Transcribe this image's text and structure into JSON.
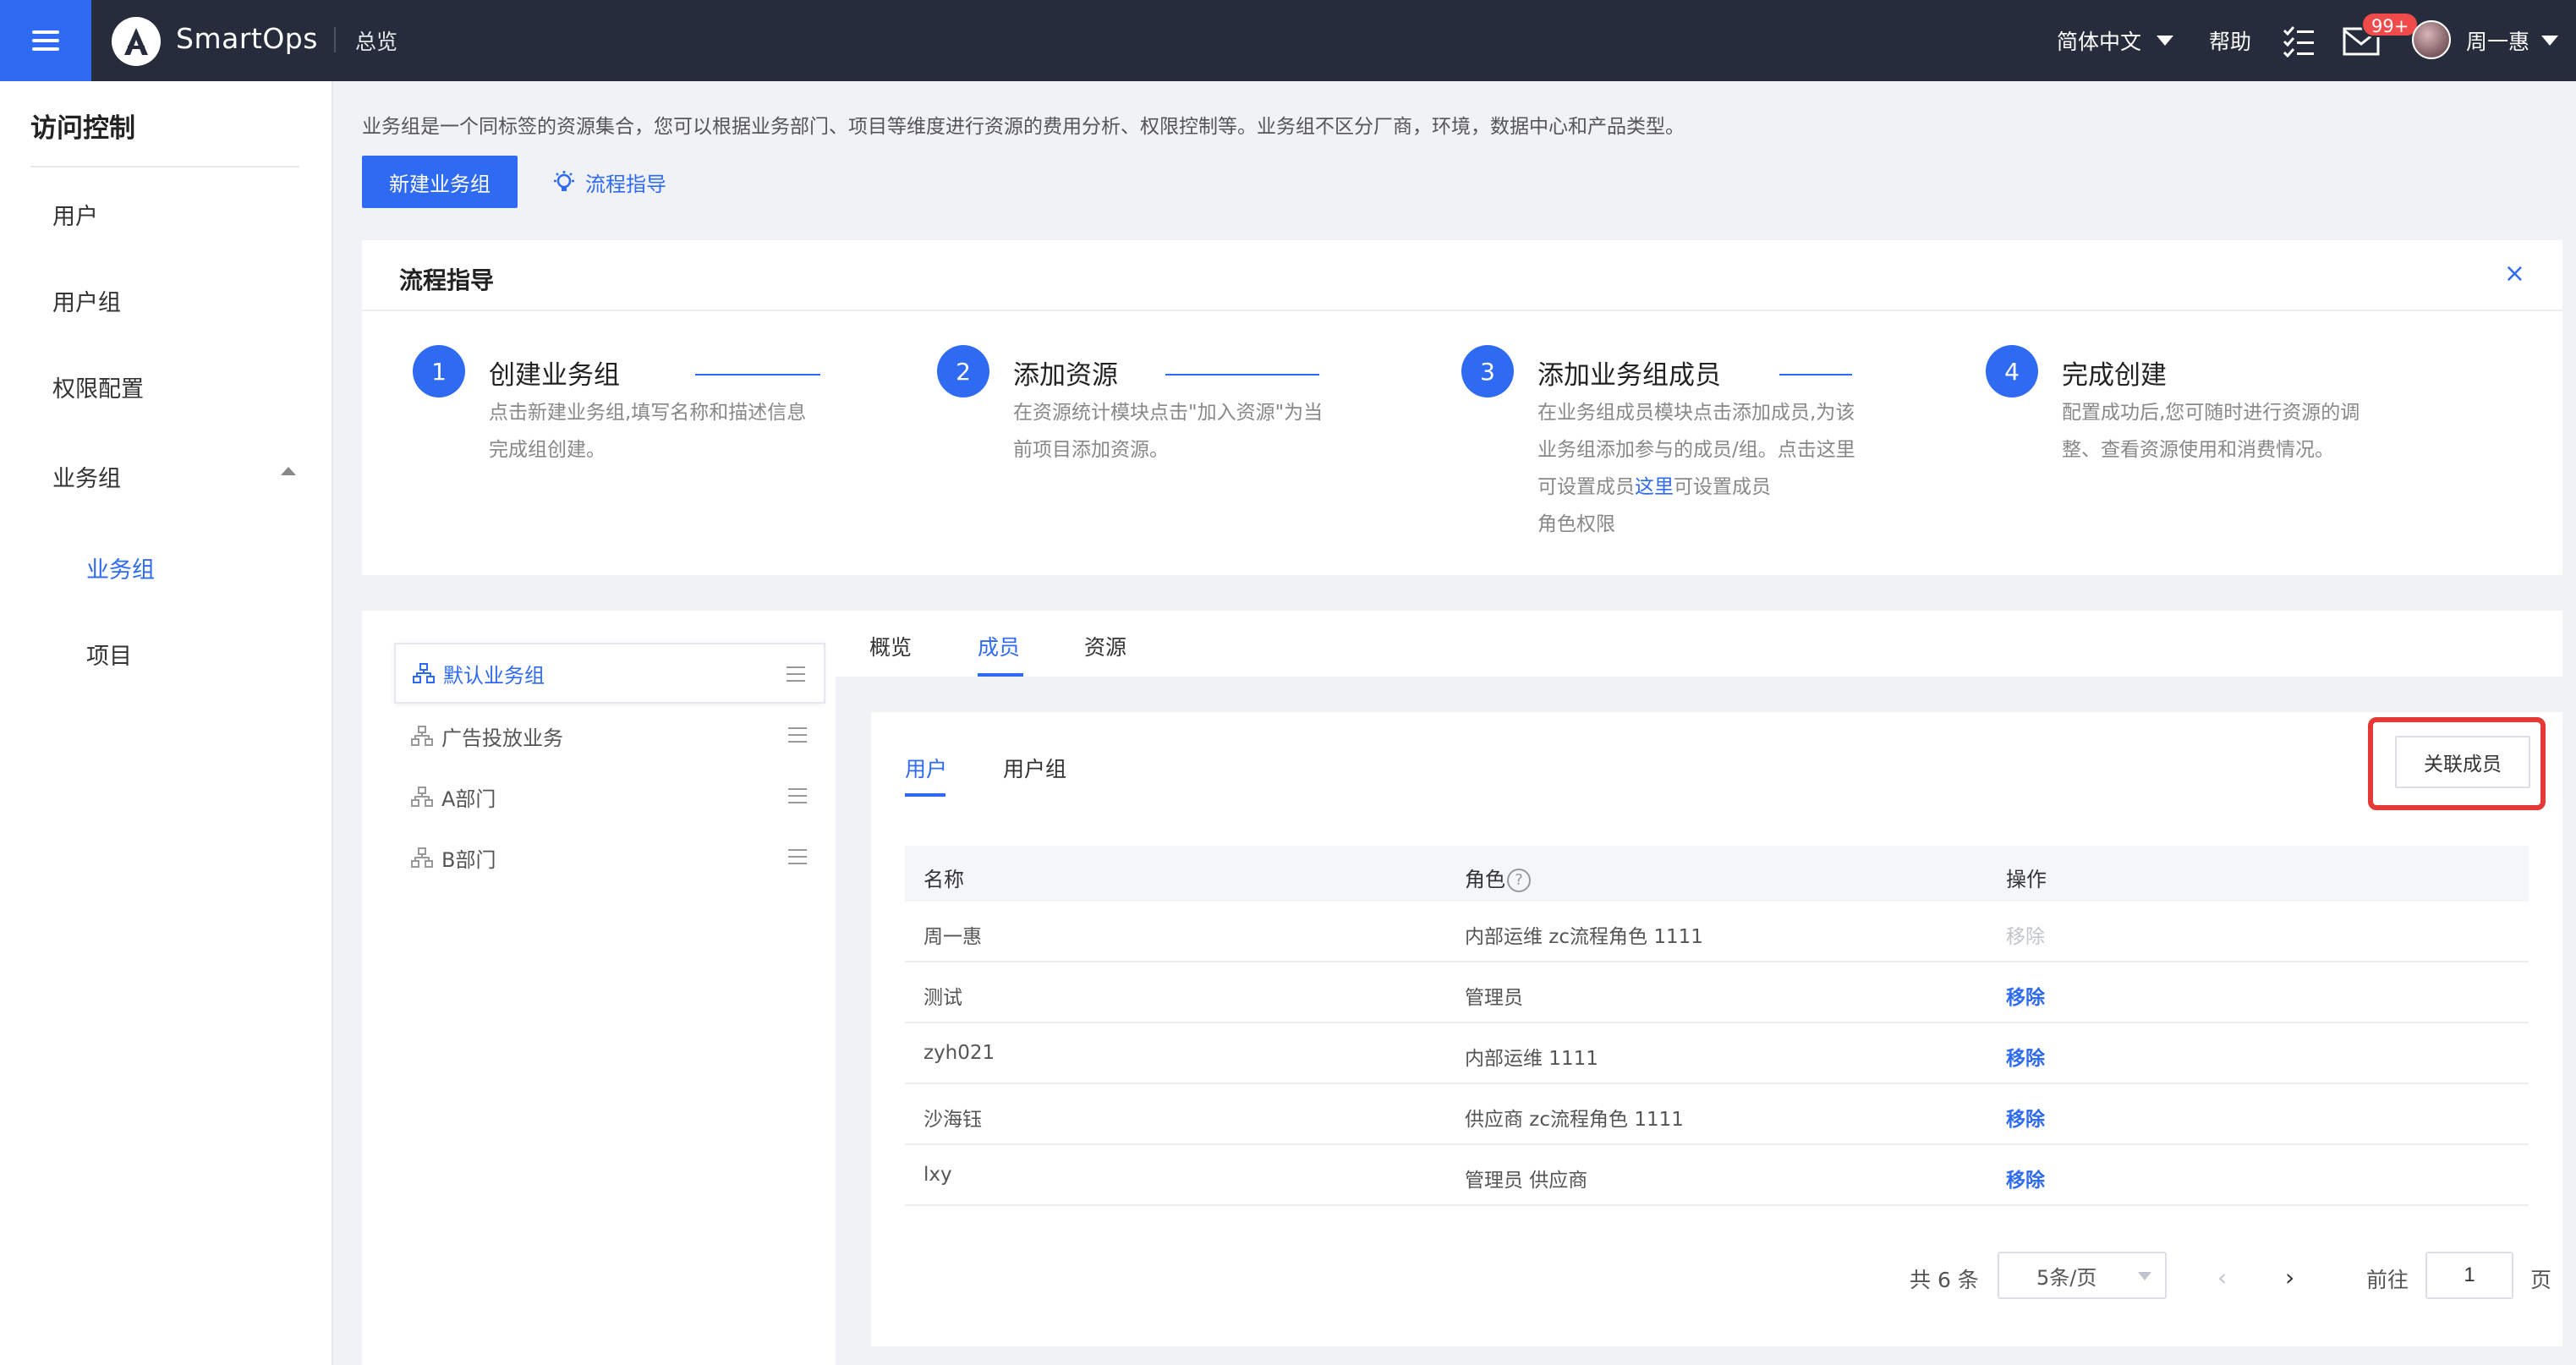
{
  "topbar": {
    "brand": "SmartOps",
    "overview": "总览",
    "language": "简体中文",
    "help": "帮助",
    "badge": "99+",
    "username": "周一惠"
  },
  "sidebar": {
    "title": "访问控制",
    "items": [
      "用户",
      "用户组",
      "权限配置",
      "业务组"
    ],
    "subitems": [
      "业务组",
      "项目"
    ]
  },
  "main": {
    "description": "业务组是一个同标签的资源集合，您可以根据业务部门、项目等维度进行资源的费用分析、权限控制等。业务组不区分厂商，环境，数据中心和产品类型。",
    "new_button": "新建业务组",
    "guide_link": "流程指导"
  },
  "guide": {
    "title": "流程指导",
    "close": "×",
    "steps": [
      {
        "num": "1",
        "name": "创建业务组",
        "lines": [
          "点击新建业务组,填写名称和描述信息",
          "完成组创建。"
        ]
      },
      {
        "num": "2",
        "name": "添加资源",
        "lines": [
          "在资源统计模块点击\"加入资源\"为当",
          "前项目添加资源。"
        ]
      },
      {
        "num": "3",
        "name": "添加业务组成员",
        "lines": [
          "在业务组成员模块点击添加成员,为该",
          "业务组添加参与的成员/组。点击这里",
          "可设置成员角色权限",
          "角色权限"
        ],
        "link": "这里",
        "line3_suffix": "可设置成员"
      },
      {
        "num": "4",
        "name": "完成创建",
        "lines": [
          "配置成功后,您可随时进行资源的调",
          "整、查看资源使用和消费情况。"
        ]
      }
    ]
  },
  "groups": [
    "默认业务组",
    "广告投放业务",
    "A部门",
    "B部门"
  ],
  "tabs": [
    "概览",
    "成员",
    "资源"
  ],
  "subtabs": [
    "用户",
    "用户组"
  ],
  "assoc_button": "关联成员",
  "table": {
    "headers": [
      "名称",
      "角色",
      "操作"
    ],
    "rows": [
      {
        "name": "周一惠",
        "role": "内部运维 zc流程角色 1111",
        "action": "移除",
        "disabled": true
      },
      {
        "name": "测试",
        "role": "管理员",
        "action": "移除",
        "disabled": false
      },
      {
        "name": "zyh021",
        "role": "内部运维 1111",
        "action": "移除",
        "disabled": false
      },
      {
        "name": "沙海钰",
        "role": "供应商 zc流程角色 1111",
        "action": "移除",
        "disabled": false
      },
      {
        "name": "lxy",
        "role": "管理员 供应商",
        "action": "移除",
        "disabled": false
      }
    ]
  },
  "pagination": {
    "total": "共 6 条",
    "page_size": "5条/页",
    "goto": "前往",
    "page": "1",
    "suffix": "页"
  },
  "colors": {
    "accent": "#2f6bf2",
    "topbar": "#262c3b",
    "highlight": "#e53935"
  }
}
